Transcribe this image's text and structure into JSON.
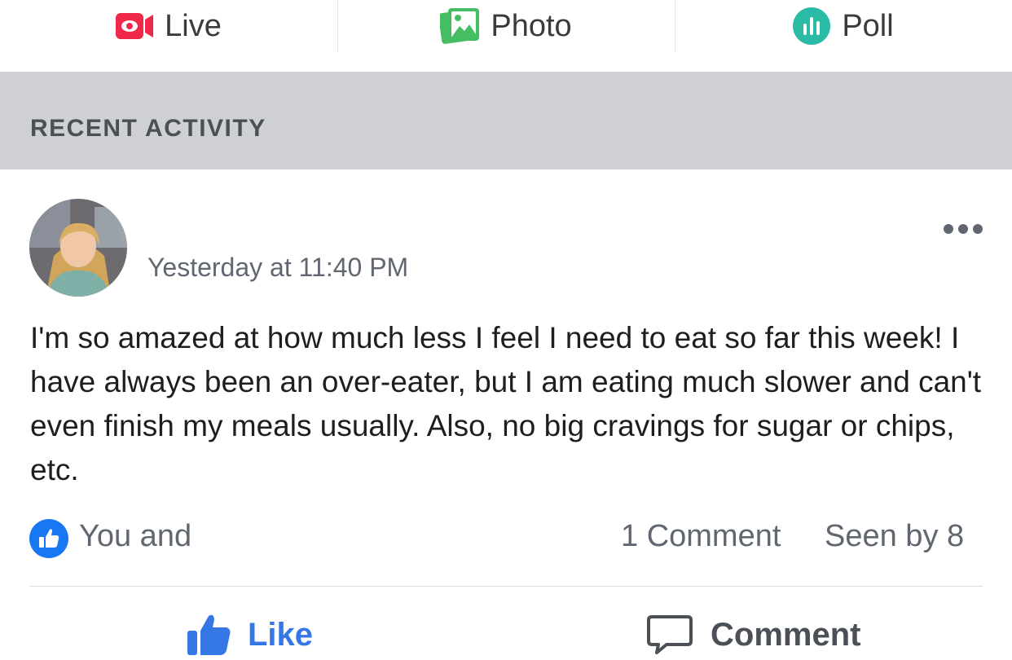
{
  "composer": {
    "live": {
      "label": "Live",
      "icon": "live-video-icon",
      "color": "#f02849"
    },
    "photo": {
      "label": "Photo",
      "icon": "photo-icon",
      "color": "#45bd62"
    },
    "poll": {
      "label": "Poll",
      "icon": "poll-icon",
      "color": "#2abba7"
    }
  },
  "section": {
    "title": "RECENT ACTIVITY"
  },
  "post": {
    "author_avatar": "avatar",
    "timestamp": "Yesterday at 11:40 PM",
    "text": "I'm so amazed at how much less I feel I need to eat so far this week! I have always been an over-eater, but I am eating much slower and can't even finish my meals usually. Also, no big cravings for sugar or chips, etc.",
    "reactions": {
      "text": "You and",
      "icon": "like-badge-icon",
      "color": "#1877f2"
    },
    "comment_count": "1 Comment",
    "seen_by": "Seen by 8"
  },
  "actions": {
    "like_label": "Like",
    "comment_label": "Comment",
    "like_color": "#3578e5"
  }
}
